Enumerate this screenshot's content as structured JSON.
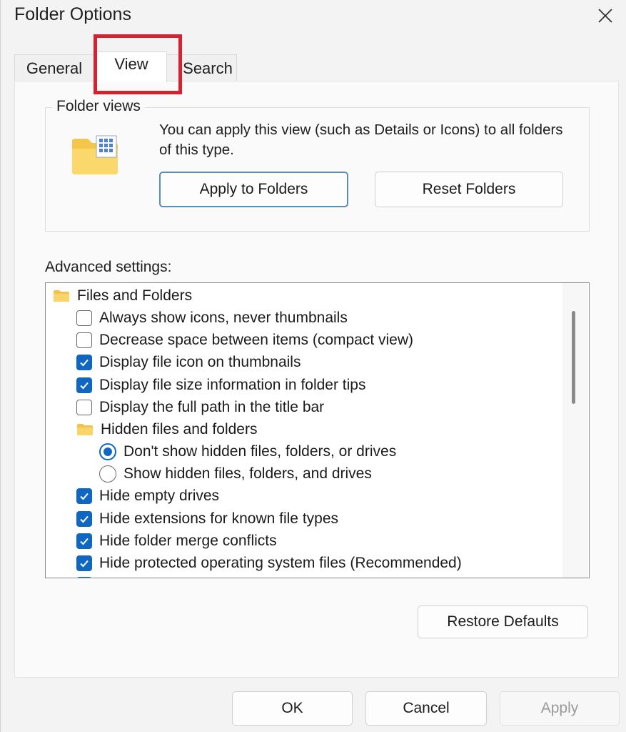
{
  "window": {
    "title": "Folder Options"
  },
  "tabs": [
    {
      "label": "General"
    },
    {
      "label": "View"
    },
    {
      "label": "Search"
    }
  ],
  "folder_views": {
    "legend": "Folder views",
    "description": "You can apply this view (such as Details or Icons) to all folders of this type.",
    "apply_button": "Apply to Folders",
    "reset_button": "Reset Folders"
  },
  "advanced": {
    "label": "Advanced settings:",
    "items": [
      {
        "type": "folder",
        "label": "Files and Folders"
      },
      {
        "type": "checkbox",
        "label": "Always show icons, never thumbnails",
        "checked": false
      },
      {
        "type": "checkbox",
        "label": "Decrease space between items (compact view)",
        "checked": false
      },
      {
        "type": "checkbox",
        "label": "Display file icon on thumbnails",
        "checked": true
      },
      {
        "type": "checkbox",
        "label": "Display file size information in folder tips",
        "checked": true
      },
      {
        "type": "checkbox",
        "label": "Display the full path in the title bar",
        "checked": false
      },
      {
        "type": "folder",
        "label": "Hidden files and folders"
      },
      {
        "type": "radio",
        "label": "Don't show hidden files, folders, or drives",
        "checked": true
      },
      {
        "type": "radio",
        "label": "Show hidden files, folders, and drives",
        "checked": false
      },
      {
        "type": "checkbox",
        "label": "Hide empty drives",
        "checked": true
      },
      {
        "type": "checkbox",
        "label": "Hide extensions for known file types",
        "checked": true
      },
      {
        "type": "checkbox",
        "label": "Hide folder merge conflicts",
        "checked": true
      },
      {
        "type": "checkbox",
        "label": "Hide protected operating system files (Recommended)",
        "checked": true
      }
    ]
  },
  "footer": {
    "restore_defaults": "Restore Defaults",
    "ok": "OK",
    "cancel": "Cancel",
    "apply": "Apply"
  },
  "colors": {
    "accent": "#0f67c2",
    "highlight": "#d6222f"
  }
}
